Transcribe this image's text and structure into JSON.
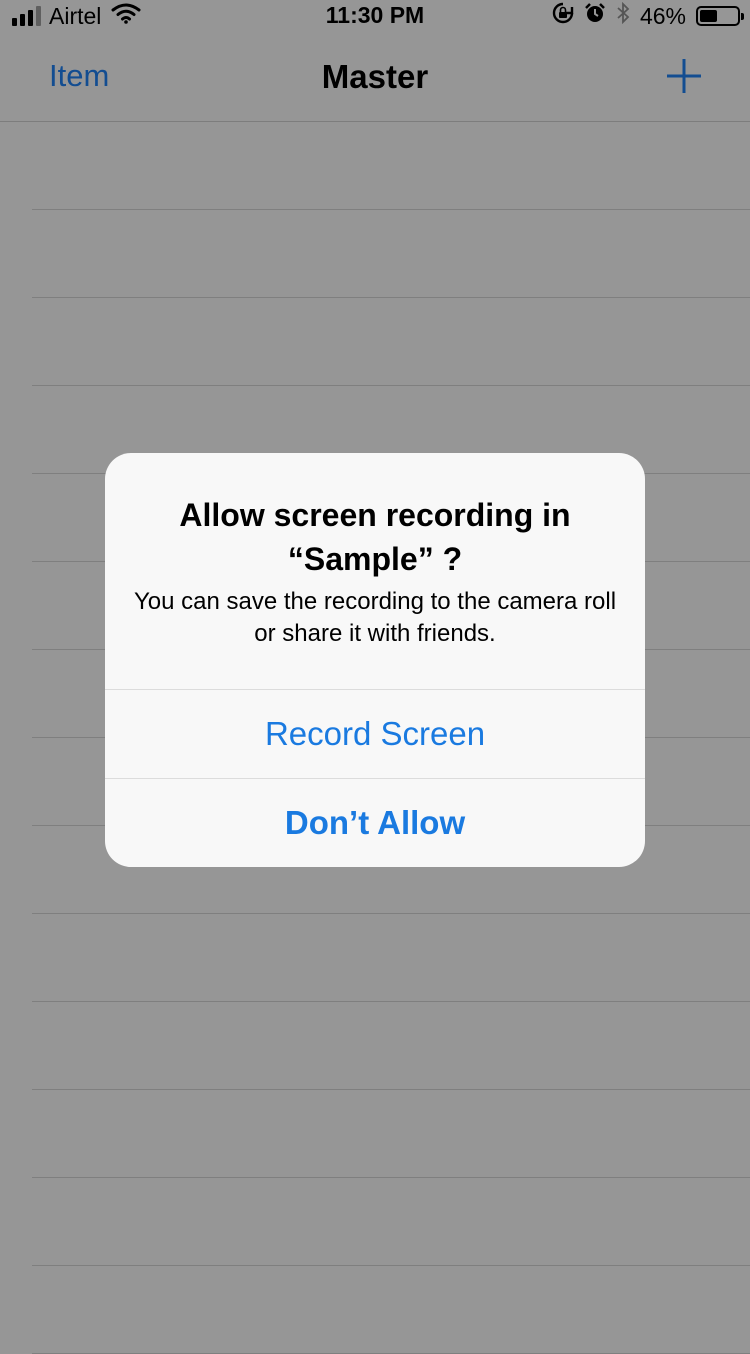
{
  "status_bar": {
    "carrier": "Airtel",
    "time": "11:30 PM",
    "battery": "46%",
    "battery_level": 0.46,
    "icons": [
      "signal-icon",
      "wifi-icon",
      "rotation-lock-icon",
      "alarm-icon",
      "bluetooth-icon",
      "battery-icon"
    ]
  },
  "nav": {
    "left_label": "Item",
    "title": "Master",
    "right_icon": "plus-icon"
  },
  "table": {
    "rows": [
      "",
      "",
      "",
      "",
      "",
      "",
      "",
      "",
      "",
      "",
      "",
      "",
      "",
      ""
    ]
  },
  "alert": {
    "title": "Allow screen recording in “Sample” ?",
    "message": "You can save the recording to the camera roll or share it with friends.",
    "buttons": [
      "Record Screen",
      "Don’t Allow"
    ]
  },
  "colors": {
    "dimmed_background": "#969696",
    "nav_tint_dimmed": "#134d91",
    "alert_button": "#1a7ae0",
    "alert_background": "#f8f8f8"
  }
}
